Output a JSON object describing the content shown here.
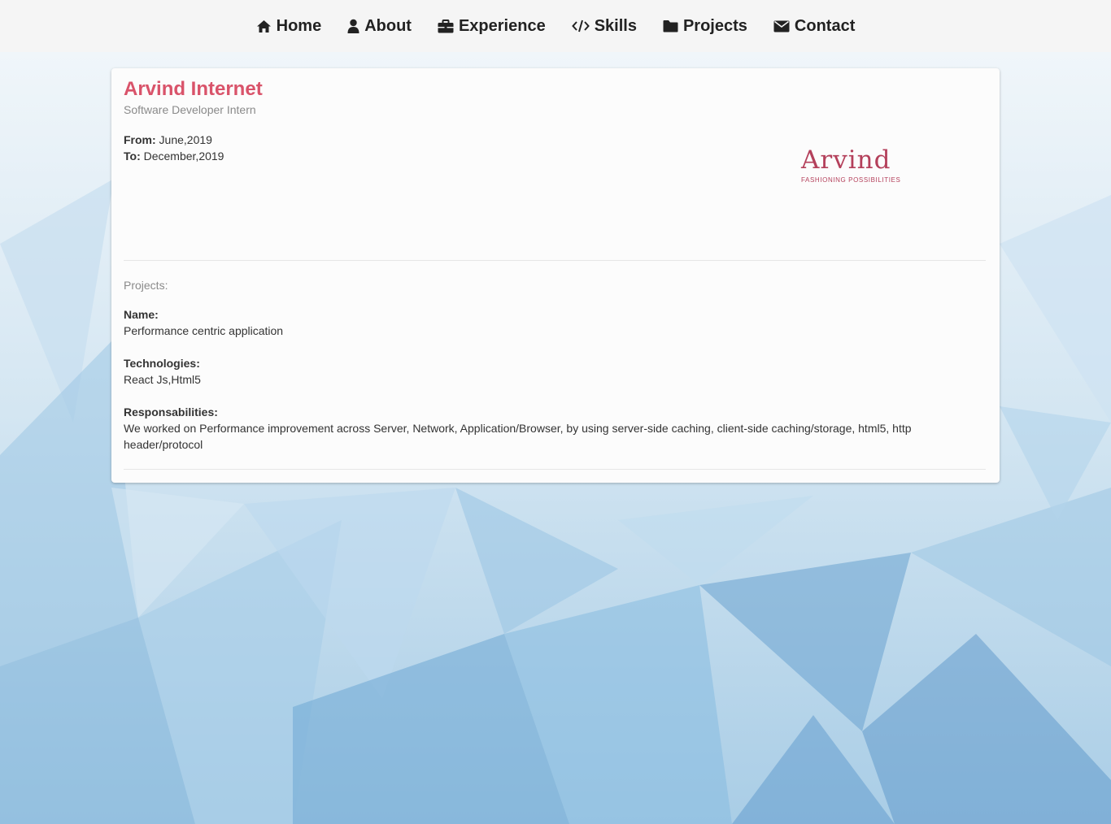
{
  "nav": {
    "items": [
      {
        "label": "Home",
        "icon": "home-icon"
      },
      {
        "label": "About",
        "icon": "user-icon"
      },
      {
        "label": "Experience",
        "icon": "briefcase-icon"
      },
      {
        "label": "Skills",
        "icon": "code-icon"
      },
      {
        "label": "Projects",
        "icon": "folder-icon"
      },
      {
        "label": "Contact",
        "icon": "envelope-icon"
      }
    ]
  },
  "experience": {
    "company": "Arvind Internet",
    "role": "Software Developer Intern",
    "from_label": "From:",
    "from_value": " June,2019",
    "to_label": "To:",
    "to_value": " December,2019",
    "logo": {
      "word": "Arvind",
      "tagline": "FASHIONING POSSIBILITIES"
    },
    "projects_label": "Projects:",
    "project": {
      "name_label": "Name:",
      "name_value": "Performance centric application",
      "tech_label": "Technologies:",
      "tech_value": "React Js,Html5",
      "resp_label": "Responsabilities:",
      "resp_value": "We worked on Performance improvement across Server, Network, Application/Browser, by using server-side caching, client-side caching/storage, html5, http header/protocol"
    }
  },
  "colors": {
    "accent": "#d9536a",
    "logo": "#b4405b",
    "nav_bg": "#f5f5f5",
    "card_bg": "#fcfcfc"
  }
}
